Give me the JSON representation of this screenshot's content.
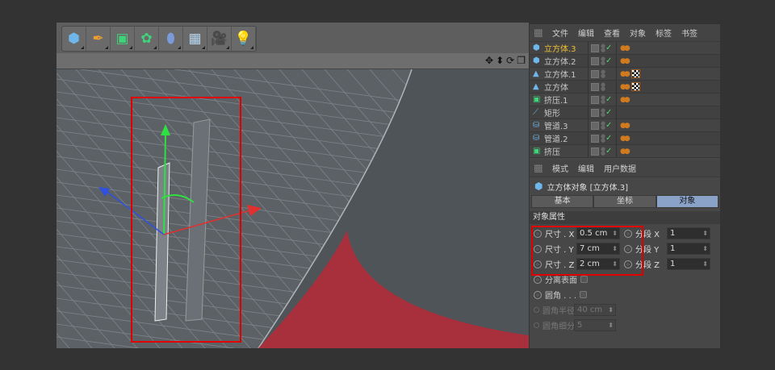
{
  "toolbar": {
    "tools": [
      {
        "icon": "cube-icon",
        "glyph": "⬢",
        "color": "#6fb6ea"
      },
      {
        "icon": "pen-spline-icon",
        "glyph": "✒",
        "color": "#f0a030"
      },
      {
        "icon": "subdivision-icon",
        "glyph": "▣",
        "color": "#3fd47a"
      },
      {
        "icon": "array-icon",
        "glyph": "✿",
        "color": "#3fd47a"
      },
      {
        "icon": "deformer-bend-icon",
        "glyph": "⬮",
        "color": "#7a9ad8"
      },
      {
        "icon": "floor-icon",
        "glyph": "▦",
        "color": "#b8d8f0"
      },
      {
        "icon": "camera-icon",
        "glyph": "🎥",
        "color": "#111"
      },
      {
        "icon": "light-icon",
        "glyph": "💡",
        "color": "#eee"
      }
    ]
  },
  "viewport": {
    "nav_icons": [
      "move-view-icon",
      "zoom-view-icon",
      "rotate-view-icon",
      "maximize-view-icon"
    ],
    "nav_glyphs": [
      "✥",
      "⬍",
      "⟳",
      "❐"
    ]
  },
  "object_manager": {
    "menu": [
      "文件",
      "编辑",
      "查看",
      "对象",
      "标签",
      "书签"
    ],
    "objects": [
      {
        "name": "立方体.3",
        "icon": "cube-icon",
        "glyph": "⬢",
        "selected": true,
        "check": true,
        "tex": false,
        "tag": true
      },
      {
        "name": "立方体.2",
        "icon": "cube-icon",
        "glyph": "⬢",
        "selected": false,
        "check": true,
        "tex": false,
        "tag": true
      },
      {
        "name": "立方体.1",
        "icon": "polygon-object-icon",
        "glyph": "▲",
        "selected": false,
        "check": false,
        "tex": true,
        "tag": true
      },
      {
        "name": "立方体",
        "icon": "polygon-object-icon",
        "glyph": "▲",
        "selected": false,
        "check": false,
        "tex": true,
        "tag": true
      },
      {
        "name": "挤压.1",
        "icon": "extrude-icon",
        "glyph": "▣",
        "selected": false,
        "check": true,
        "tex": false,
        "tag": true
      },
      {
        "name": "矩形",
        "icon": "spline-icon",
        "glyph": "⟋",
        "selected": false,
        "check": true,
        "tex": false,
        "tag": false
      },
      {
        "name": "管道.3",
        "icon": "tube-icon",
        "glyph": "⛁",
        "selected": false,
        "check": true,
        "tex": false,
        "tag": true
      },
      {
        "name": "管道.2",
        "icon": "tube-icon",
        "glyph": "⛁",
        "selected": false,
        "check": true,
        "tex": false,
        "tag": true
      },
      {
        "name": "挤压",
        "icon": "extrude-icon",
        "glyph": "▣",
        "selected": false,
        "check": true,
        "tex": false,
        "tag": true
      }
    ]
  },
  "attributes": {
    "menu": [
      "模式",
      "编辑",
      "用户数据"
    ],
    "title": "立方体对象 [立方体.3]",
    "tabs": [
      "基本",
      "坐标",
      "对象"
    ],
    "active_tab": "对象",
    "section": "对象属性",
    "size": [
      {
        "label": "尺寸 . X",
        "value": "0.5 cm"
      },
      {
        "label": "尺寸 . Y",
        "value": "7 cm"
      },
      {
        "label": "尺寸 . Z",
        "value": "2 cm"
      }
    ],
    "segments": [
      {
        "label": "分段 X",
        "value": "1"
      },
      {
        "label": "分段 Y",
        "value": "1"
      },
      {
        "label": "分段 Z",
        "value": "1"
      }
    ],
    "separate_surfaces": "分离表面",
    "fillet": "圆角 . . .",
    "fillet_radius": {
      "label": "圆角半径",
      "value": "40 cm"
    },
    "fillet_subdivision": {
      "label": "圆角细分",
      "value": "5"
    }
  },
  "colors": {
    "highlight_box": "#e00000",
    "active_tab": "#8aa2c8",
    "selected_object": "#f0c030",
    "red_surface": "#a8303c"
  }
}
